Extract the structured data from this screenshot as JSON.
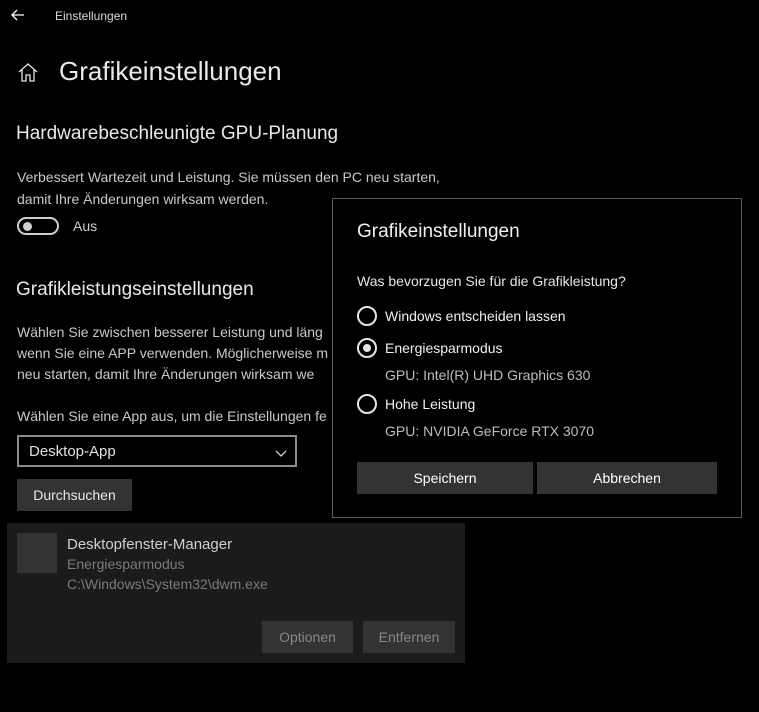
{
  "window": {
    "title": "Einstellungen"
  },
  "page": {
    "title": "Grafikeinstellungen"
  },
  "gpu_scheduling": {
    "heading": "Hardwarebeschleunigte GPU-Planung",
    "description_lines": [
      "Verbessert Wartezeit und Leistung. Sie müssen den PC neu starten,",
      "damit Ihre Änderungen wirksam werden."
    ],
    "toggle_label": "Aus"
  },
  "performance": {
    "heading": "Grafikleistungseinstellungen",
    "description_lines": [
      "Wählen Sie zwischen besserer Leistung und läng",
      "wenn Sie eine APP verwenden. Möglicherweise m",
      "neu starten, damit Ihre Änderungen wirksam we"
    ],
    "select_label": "Wählen Sie eine App aus, um die Einstellungen fe",
    "select_value": "Desktop-App",
    "browse_label": "Durchsuchen"
  },
  "app_card": {
    "name": "Desktopfenster-Manager",
    "mode": "Energiesparmodus",
    "path": "C:\\Windows\\System32\\dwm.exe",
    "options_label": "Optionen",
    "remove_label": "Entfernen"
  },
  "dialog": {
    "title": "Grafikeinstellungen",
    "question": "Was bevorzugen Sie für die Grafikleistung?",
    "options": [
      {
        "label": "Windows entscheiden lassen",
        "selected": false
      },
      {
        "label": "Energiesparmodus",
        "gpu": "GPU: Intel(R) UHD Graphics 630",
        "selected": true
      },
      {
        "label": "Hohe Leistung",
        "gpu": "GPU: NVIDIA GeForce RTX 3070",
        "selected": false
      }
    ],
    "save_label": "Speichern",
    "cancel_label": "Abbrechen"
  },
  "icons": {
    "back": "back-arrow-icon",
    "home": "home-icon",
    "dropdown": "chevron-down-icon"
  }
}
